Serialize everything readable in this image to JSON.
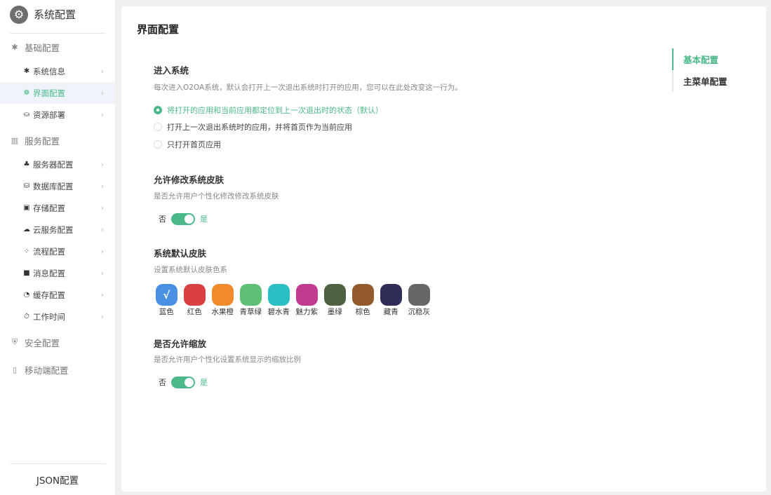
{
  "sidebar": {
    "title": "系统配置",
    "logo_icon": "gear-icon",
    "groups": [
      {
        "label": "基础配置",
        "icon": "gear-icon",
        "items": [
          {
            "label": "系统信息",
            "icon": "gear-icon"
          },
          {
            "label": "界面配置",
            "icon": "palette-icon",
            "active": true
          },
          {
            "label": "资源部署",
            "icon": "deploy-icon"
          }
        ]
      },
      {
        "label": "服务配置",
        "icon": "server-rack-icon",
        "items": [
          {
            "label": "服务器配置",
            "icon": "server-icon"
          },
          {
            "label": "数据库配置",
            "icon": "database-icon"
          },
          {
            "label": "存储配置",
            "icon": "storage-icon"
          },
          {
            "label": "云服务配置",
            "icon": "cloud-icon"
          },
          {
            "label": "流程配置",
            "icon": "flow-icon"
          },
          {
            "label": "消息配置",
            "icon": "message-icon"
          },
          {
            "label": "缓存配置",
            "icon": "cache-icon"
          },
          {
            "label": "工作时间",
            "icon": "timer-icon"
          }
        ]
      },
      {
        "label": "安全配置",
        "icon": "shield-icon",
        "items": []
      },
      {
        "label": "移动端配置",
        "icon": "mobile-icon",
        "items": []
      }
    ],
    "footer_label": "JSON配置"
  },
  "main": {
    "title": "界面配置",
    "sections": {
      "enter_system": {
        "title": "进入系统",
        "desc": "每次进入O2OA系统，默认会打开上一次退出系统时打开的应用，您可以在此处改变这一行为。",
        "options": [
          {
            "label": "将打开的应用和当前应用都定位到上一次退出时的状态（默认）",
            "checked": true
          },
          {
            "label": "打开上一次退出系统时的应用，并将首页作为当前应用",
            "checked": false
          },
          {
            "label": "只打开首页应用",
            "checked": false
          }
        ]
      },
      "skin_modify": {
        "title": "允许修改系统皮肤",
        "desc": "是否允许用户个性化修改修改系统皮肤",
        "off_label": "否",
        "on_label": "是",
        "value": true
      },
      "default_skin": {
        "title": "系统默认皮肤",
        "desc": "设置系统默认皮肤色系",
        "check_mark": "√",
        "colors": [
          {
            "label": "蓝色",
            "color": "#4a90e2",
            "selected": true
          },
          {
            "label": "红色",
            "color": "#d94040"
          },
          {
            "label": "水果橙",
            "color": "#f08a2a"
          },
          {
            "label": "青草绿",
            "color": "#5dc075"
          },
          {
            "label": "碧水青",
            "color": "#2bbfc4"
          },
          {
            "label": "魅力紫",
            "color": "#c33a93"
          },
          {
            "label": "墨绿",
            "color": "#4e6140"
          },
          {
            "label": "棕色",
            "color": "#935a2b"
          },
          {
            "label": "藏青",
            "color": "#2e2d58"
          },
          {
            "label": "沉稳灰",
            "color": "#676767"
          }
        ]
      },
      "zoom": {
        "title": "是否允许缩放",
        "desc": "是否允许用户个性化设置系统显示的缩放比例",
        "off_label": "否",
        "on_label": "是",
        "value": true
      }
    },
    "anchor_nav": [
      {
        "label": "基本配置",
        "active": true
      },
      {
        "label": "主菜单配置",
        "active": false
      }
    ]
  },
  "colors": {
    "accent": "#4cb98a",
    "active_bg": "#eef4f9"
  }
}
